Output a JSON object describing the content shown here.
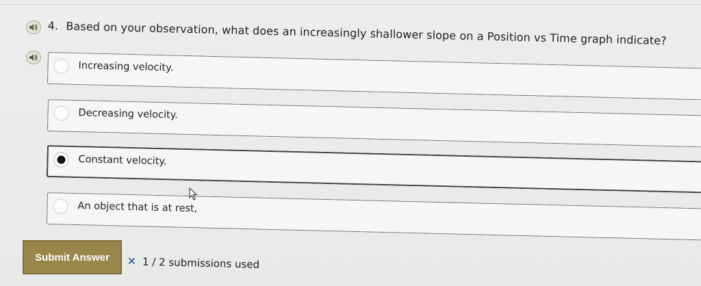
{
  "question": {
    "number": "4.",
    "text": "Based on your observation, what does an increasingly shallower slope on a Position vs Time graph indicate?"
  },
  "options": [
    {
      "label": "Increasing velocity.",
      "selected": false
    },
    {
      "label": "Decreasing velocity.",
      "selected": false
    },
    {
      "label": "Constant velocity.",
      "selected": true
    },
    {
      "label": "An object that is at rest,",
      "selected": false
    }
  ],
  "submit": {
    "label": "Submit Answer"
  },
  "status": {
    "icon": "x-icon",
    "symbol": "✕",
    "text": "1 / 2 submissions used"
  },
  "colors": {
    "submit_bg": "#98864a",
    "status_x": "#1a5aa0"
  },
  "icons": {
    "audio": "speaker-icon"
  }
}
